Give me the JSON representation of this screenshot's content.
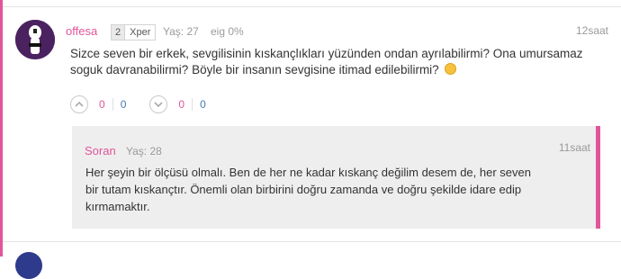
{
  "comment": {
    "username": "offesa",
    "level": "2",
    "level_label": "Xper",
    "age": "Yaş: 27",
    "eig": "eig 0%",
    "time": "12saat",
    "text_line1": "Sizce seven bir erkek, sevgilisinin kıskançlıkları yüzünden ondan ayrılabilirmi? Ona umursamaz",
    "text_line2": "soguk davranabilirmi? Böyle bir insanın sevgisine itimad edilebilirmi?",
    "smiley_icon": "smiley-icon",
    "votes": {
      "up_like": "0",
      "up_dislike": "0",
      "down_like": "0",
      "down_dislike": "0"
    }
  },
  "reply": {
    "username": "Soran",
    "age": "Yaş: 28",
    "time": "11saat",
    "text_line1": "Her şeyin bir ölçüsü olmalı. Ben de her ne kadar kıskanç değilim desem de, her seven",
    "text_line2": "bir tutam kıskançtır. Önemli olan birbirini doğru zamanda ve doğru şekilde idare edip",
    "text_line3": "kırmamaktır."
  },
  "colors": {
    "accent": "#e0559b",
    "dislike": "#4a7ab0",
    "meta": "#9a9a9a",
    "reply_bg": "#eeeeee"
  }
}
